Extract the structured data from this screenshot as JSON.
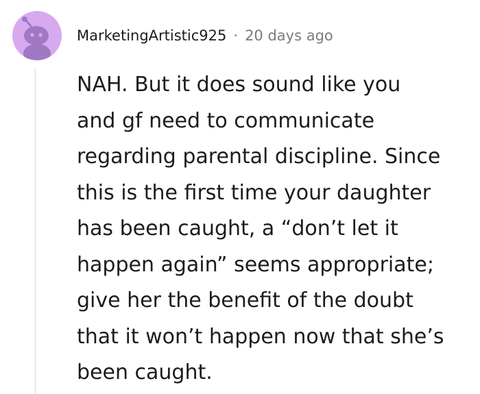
{
  "comment": {
    "username": "MarketingArtistic925",
    "separator": "·",
    "timestamp": "20 days ago",
    "avatar_icon": "snoo-avatar-icon",
    "avatar_color": "#d7aaf0",
    "avatar_figure_color": "#a078c4",
    "body_lines": [
      "NAH. But it does sound like you",
      "and gf need to communicate",
      "regarding parental discipline. Since",
      "this is the first time your daughter",
      "has been caught, a “don’t let it",
      "happen again” seems appropriate;",
      "give her the benefit of the doubt",
      "that it won’t happen now that she’s",
      "been caught."
    ]
  }
}
